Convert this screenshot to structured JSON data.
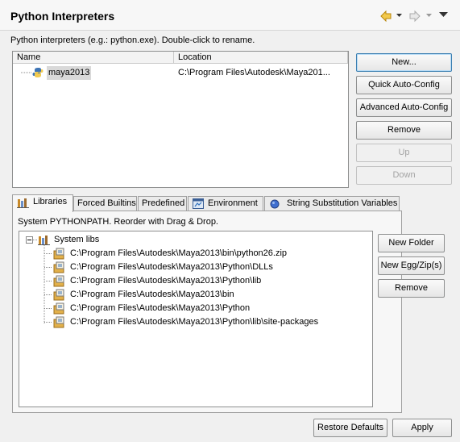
{
  "header": {
    "title": "Python Interpreters",
    "icons": [
      "back-arrow-icon",
      "dropdown-arrow-icon",
      "forward-arrow-icon",
      "dropdown-arrow-icon",
      "view-menu-icon"
    ]
  },
  "interpreters": {
    "hint": "Python interpreters (e.g.: python.exe).  Double-click to rename.",
    "columns": [
      "Name",
      "Location"
    ],
    "rows": [
      {
        "name": "maya2013",
        "location": "C:\\Program Files\\Autodesk\\Maya201..."
      }
    ],
    "buttons": {
      "new": "New...",
      "quick_auto_config": "Quick Auto-Config",
      "advanced_auto_config": "Advanced Auto-Config",
      "remove": "Remove",
      "up": "Up",
      "down": "Down"
    }
  },
  "tabs": [
    {
      "label": "Libraries",
      "icon": "libraries-icon",
      "active": true
    },
    {
      "label": "Forced Builtins",
      "active": false
    },
    {
      "label": "Predefined",
      "active": false
    },
    {
      "label": "Environment",
      "icon": "environment-icon",
      "active": false
    },
    {
      "label": "String Substitution Variables",
      "icon": "variable-icon",
      "active": false
    }
  ],
  "libraries": {
    "hint": "System PYTHONPATH.   Reorder with Drag & Drop.",
    "root": "System libs",
    "paths": [
      "C:\\Program Files\\Autodesk\\Maya2013\\bin\\python26.zip",
      "C:\\Program Files\\Autodesk\\Maya2013\\Python\\DLLs",
      "C:\\Program Files\\Autodesk\\Maya2013\\Python\\lib",
      "C:\\Program Files\\Autodesk\\Maya2013\\bin",
      "C:\\Program Files\\Autodesk\\Maya2013\\Python",
      "C:\\Program Files\\Autodesk\\Maya2013\\Python\\lib\\site-packages"
    ],
    "buttons": {
      "new_folder": "New Folder",
      "new_egg_zip": "New Egg/Zip(s)",
      "remove": "Remove"
    }
  },
  "footer": {
    "restore_defaults": "Restore Defaults",
    "apply": "Apply"
  },
  "colors": {
    "accent": "#3c7fb1",
    "selection": "#d9d9d9",
    "nav_arrow": "#e8b830"
  }
}
